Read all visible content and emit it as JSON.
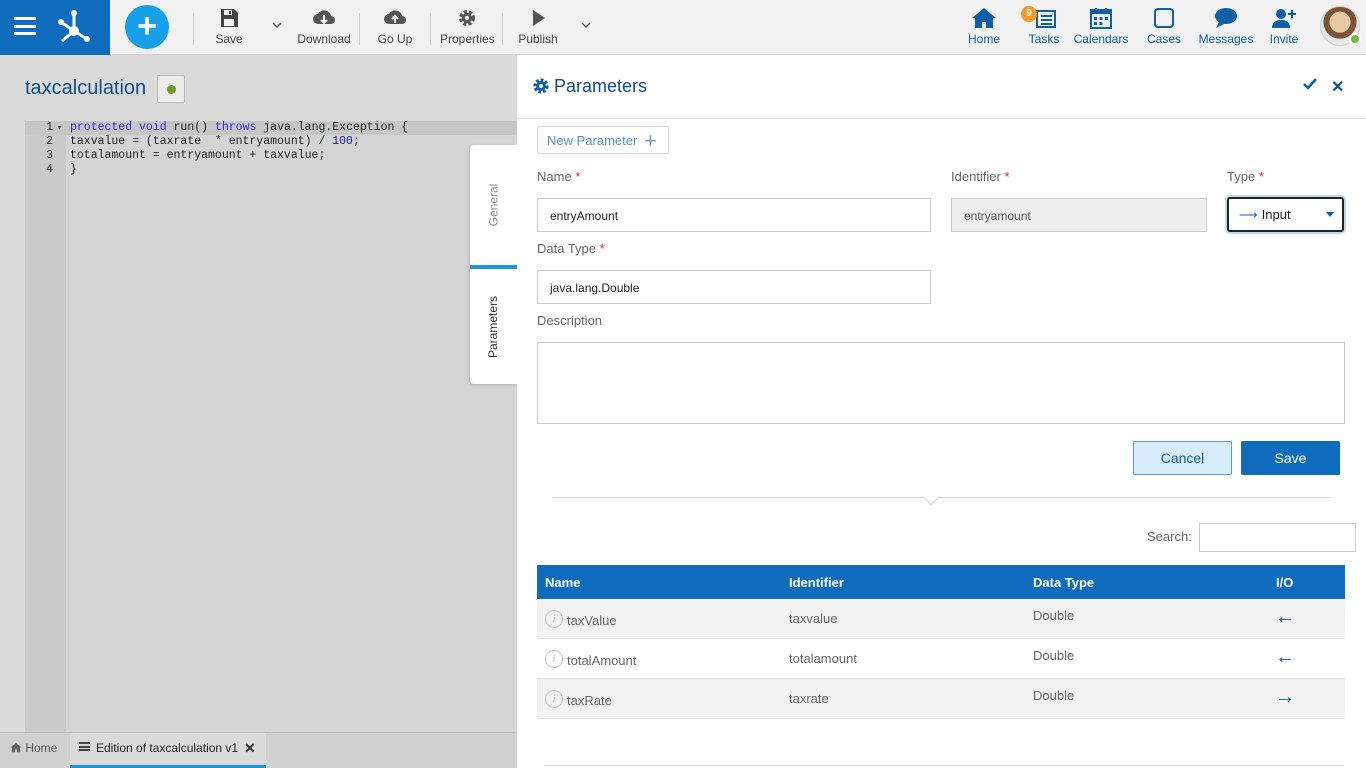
{
  "toolbar": {
    "save_label": "Save",
    "download_label": "Download",
    "goup_label": "Go Up",
    "properties_label": "Properties",
    "publish_label": "Publish"
  },
  "nav": {
    "home_label": "Home",
    "tasks_label": "Tasks",
    "tasks_badge": "9",
    "calendars_label": "Calendars",
    "cases_label": "Cases",
    "messages_label": "Messages",
    "invite_label": "Invite"
  },
  "editor": {
    "title": "taxcalculation",
    "lines": [
      {
        "num": "1",
        "segments": [
          [
            "kw",
            "protected void"
          ],
          [
            "",
            " run() "
          ],
          [
            "kw",
            "throws"
          ],
          [
            "",
            " java.lang.Exception {"
          ]
        ]
      },
      {
        "num": "2",
        "segments": [
          [
            "",
            "taxvalue = (taxrate  * entryamount) / "
          ],
          [
            "num",
            "100"
          ],
          [
            "",
            ";"
          ]
        ]
      },
      {
        "num": "3",
        "segments": [
          [
            "",
            "totalamount = entryamount + taxvalue;"
          ]
        ]
      },
      {
        "num": "4",
        "segments": [
          [
            "",
            "}"
          ]
        ]
      }
    ]
  },
  "vtabs": {
    "general": "General",
    "parameters": "Parameters"
  },
  "bottom_tabs": {
    "home": "Home",
    "edition": "Edition of taxcalculation v1"
  },
  "panel": {
    "title": "Parameters",
    "new_parameter": "New Parameter",
    "name_label": "Name",
    "name_value": "entryAmount",
    "identifier_label": "Identifier",
    "identifier_value": "entryamount",
    "type_label": "Type",
    "type_value": "Input",
    "datatype_label": "Data Type",
    "datatype_value": "java.lang.Double",
    "description_label": "Description",
    "description_value": "",
    "required_mark": "*",
    "cancel_label": "Cancel",
    "save_label": "Save",
    "search_label": "Search:",
    "search_value": ""
  },
  "table": {
    "headers": [
      "Name",
      "Identifier",
      "Data Type",
      "I/O"
    ],
    "rows": [
      {
        "name": "taxValue",
        "identifier": "taxvalue",
        "datatype": "Double",
        "io": "←"
      },
      {
        "name": "totalAmount",
        "identifier": "totalamount",
        "datatype": "Double",
        "io": "←"
      },
      {
        "name": "taxRate",
        "identifier": "taxrate",
        "datatype": "Double",
        "io": "→"
      }
    ]
  },
  "colors": {
    "brand_blue": "#0f6cbd",
    "accent_cyan": "#16a0e8",
    "status_green": "#6e9a2a",
    "badge_orange": "#f59a23"
  },
  "icons": {
    "menu": "hamburger-icon",
    "logo": "app-logo-icon",
    "add": "plus-icon",
    "save": "floppy-icon",
    "download": "cloud-download-icon",
    "goup": "cloud-upload-icon",
    "properties": "gear-icon",
    "publish": "play-icon",
    "home": "house-icon",
    "tasks": "tasks-icon",
    "calendars": "calendar-icon",
    "cases": "square-icon",
    "messages": "chat-icon",
    "invite": "add-user-icon"
  }
}
